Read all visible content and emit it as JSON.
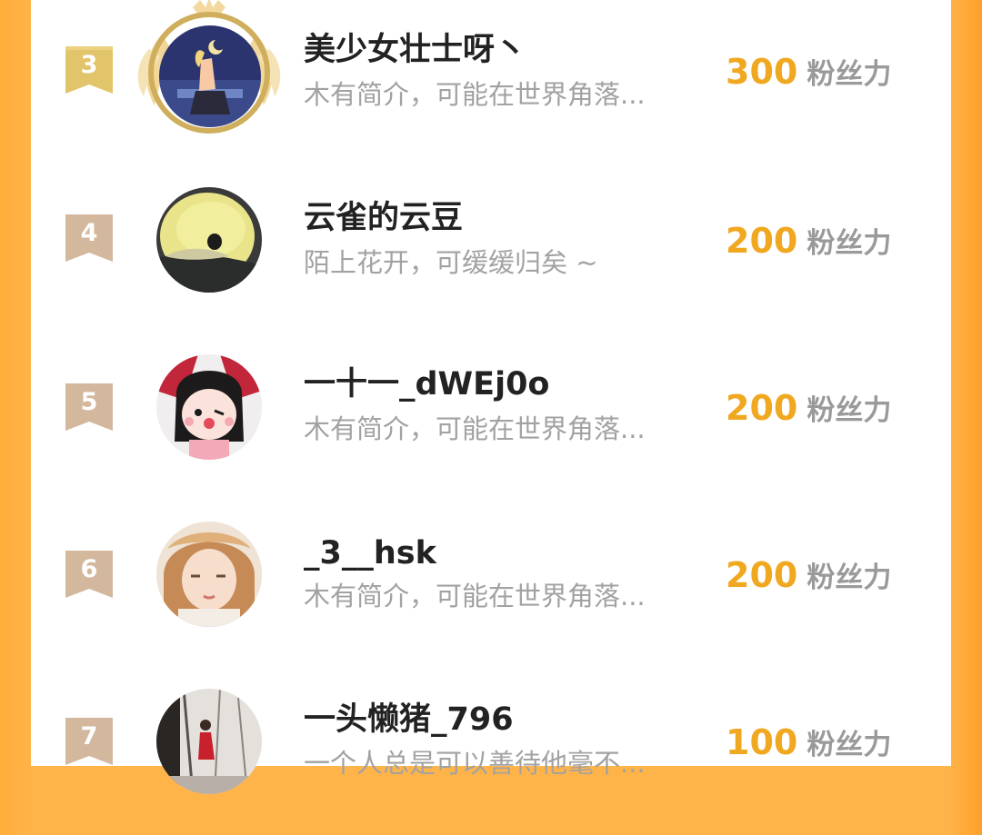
{
  "theme": {
    "accent": "#f0a820",
    "background": "#ffb44a",
    "badge_gold": "#e6c76a",
    "badge_tan": "#d2b59b"
  },
  "ranking": {
    "unit": "粉丝力",
    "rows": [
      {
        "rank": "3",
        "name": "美少女壮士呀丶",
        "bio": "木有简介，可能在世界角落...",
        "score": "300",
        "badge": "gold",
        "frame": "laurel-frame"
      },
      {
        "rank": "4",
        "name": "云雀的云豆",
        "bio": "陌上花开，可缓缓归矣 ~",
        "score": "200",
        "badge": "tan"
      },
      {
        "rank": "5",
        "name": "一十一_dWEj0o",
        "bio": "木有简介，可能在世界角落...",
        "score": "200",
        "badge": "tan"
      },
      {
        "rank": "6",
        "name": "_3__hsk",
        "bio": "木有简介，可能在世界角落...",
        "score": "200",
        "badge": "tan"
      },
      {
        "rank": "7",
        "name": "一头懒猪_796",
        "bio": "一个人总是可以善待他毫不...",
        "score": "100",
        "badge": "tan"
      }
    ]
  }
}
